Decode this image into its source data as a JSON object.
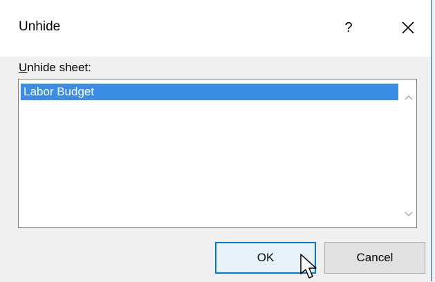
{
  "dialog": {
    "title": "Unhide",
    "help_label": "?",
    "close_icon": "close-icon"
  },
  "list": {
    "label_accel": "U",
    "label_rest": "nhide sheet:",
    "items": [
      {
        "label": "Labor Budget",
        "selected": true
      }
    ]
  },
  "buttons": {
    "ok_label": "OK",
    "cancel_label": "Cancel"
  },
  "colors": {
    "selection": "#3b8de4",
    "focus_border": "#0078d7",
    "window_border": "#7a9cc4"
  }
}
